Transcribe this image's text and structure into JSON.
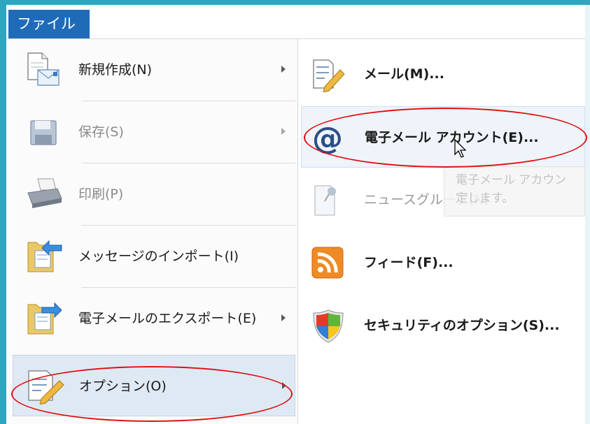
{
  "ribbon": {
    "file_tab": "ファイル"
  },
  "left_menu": {
    "items": [
      {
        "label": "新規作成(N)",
        "icon": "new-document-icon",
        "has_submenu": true,
        "disabled": false
      },
      {
        "label": "保存(S)",
        "icon": "save-disk-icon",
        "has_submenu": true,
        "disabled": true
      },
      {
        "label": "印刷(P)",
        "icon": "printer-icon",
        "has_submenu": false,
        "disabled": true
      },
      {
        "label": "メッセージのインポート(I)",
        "icon": "import-folder-icon",
        "has_submenu": false,
        "disabled": false
      },
      {
        "label": "電子メールのエクスポート(E)",
        "icon": "export-folder-icon",
        "has_submenu": true,
        "disabled": false
      },
      {
        "label": "オプション(O)",
        "icon": "options-pencil-icon",
        "has_submenu": true,
        "disabled": false,
        "selected": true
      }
    ]
  },
  "submenu": {
    "items": [
      {
        "label": "メール(M)...",
        "icon": "mail-pencil-icon",
        "disabled": false
      },
      {
        "label": "電子メール アカウント(E)...",
        "icon": "at-sign-icon",
        "disabled": false,
        "hover": true
      },
      {
        "label": "ニュースグループ(N)",
        "icon": "newsgroup-pin-icon",
        "disabled": true
      },
      {
        "label": "フィード(F)...",
        "icon": "rss-feed-icon",
        "disabled": false
      },
      {
        "label": "セキュリティのオプション(S)...",
        "icon": "security-shield-icon",
        "disabled": false
      }
    ]
  },
  "tooltip": {
    "line1": "電子メール アカウン",
    "line2": "定します。"
  },
  "colors": {
    "accent": "#1f6bb8",
    "frame": "#2fa6bf",
    "annotation": "#e01010",
    "rss": "#f08a24"
  }
}
